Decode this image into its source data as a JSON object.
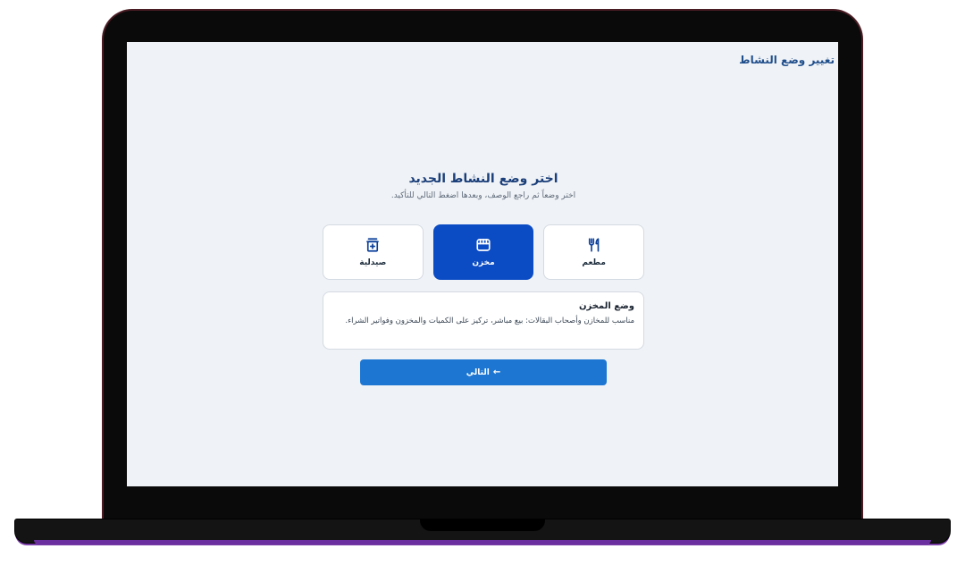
{
  "header": {
    "title": "تغيير وضع النشاط"
  },
  "main": {
    "title": "اختر وضع النشاط الجديد",
    "subtitle": "اختر وضعاً ثم راجع الوصف، وبعدها اضغط التالي للتأكيد."
  },
  "options": [
    {
      "label": "مطعم",
      "icon": "fork-knife-icon",
      "selected": false
    },
    {
      "label": "مخزن",
      "icon": "store-icon",
      "selected": true
    },
    {
      "label": "صيدلية",
      "icon": "pharmacy-icon",
      "selected": false
    }
  ],
  "description": {
    "title": "وضع المخزن",
    "text": "مناسب للمخازن وأصحاب البقالات: بيع مباشر، تركيز على الكميات والمخزون وفواتير الشراء."
  },
  "actions": {
    "next_label": "التالي",
    "next_icon": "arrow-left-icon"
  },
  "colors": {
    "accent": "#0b4bc4",
    "button": "#1c76d2",
    "background": "#eff2f6"
  }
}
